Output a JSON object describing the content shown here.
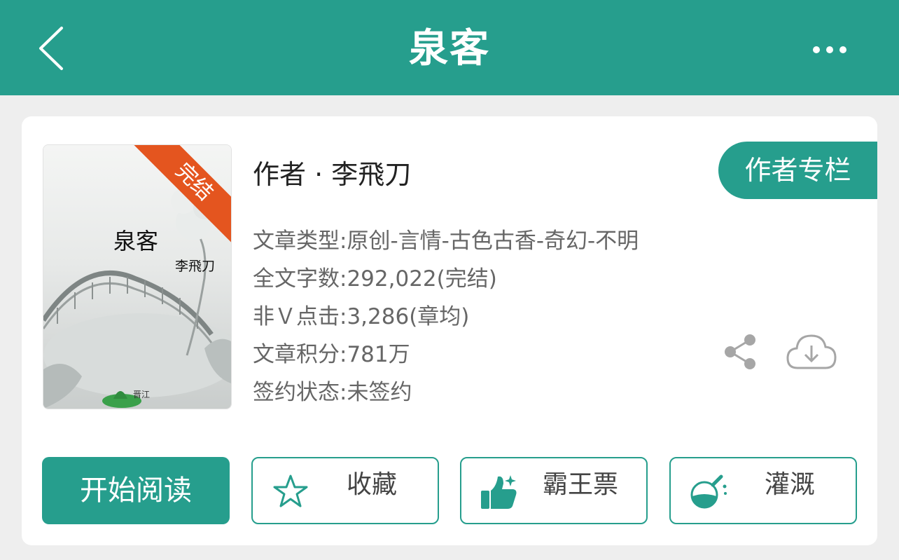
{
  "header": {
    "title": "泉客"
  },
  "book": {
    "cover": {
      "title": "泉客",
      "author": "李飛刀",
      "status_ribbon": "完结"
    },
    "author_line": "作者 · 李飛刀",
    "author_column_label": "作者专栏",
    "info": [
      "文章类型:原创-言情-古色古香-奇幻-不明",
      "全文字数:292,022(完结)",
      "非Ｖ点击:3,286(章均)",
      "文章积分:781万",
      "签约状态:未签约"
    ]
  },
  "actions": {
    "read_label": "开始阅读",
    "favorite_label": "收藏",
    "vote_label": "霸王票",
    "nutrient_label": "灌溉"
  },
  "colors": {
    "accent": "#269e8d",
    "ribbon": "#e4551f"
  },
  "icons": [
    "back-arrow-icon",
    "more-icon",
    "share-icon",
    "cloud-download-icon",
    "star-icon",
    "thumbs-up-icon",
    "flask-icon"
  ]
}
